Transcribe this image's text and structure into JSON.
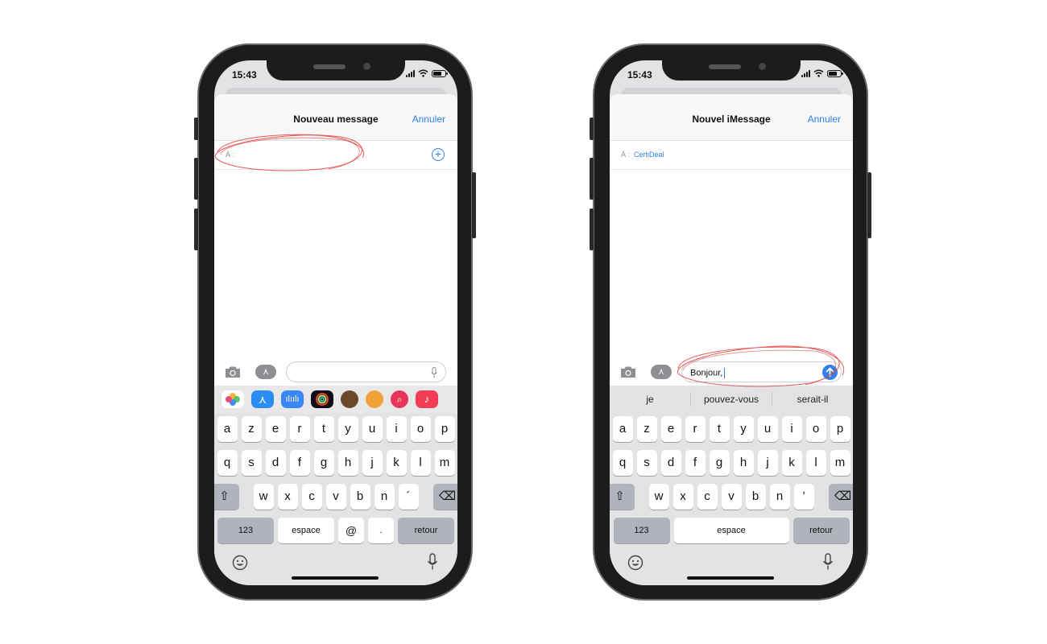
{
  "left_phone": {
    "time": "15:43",
    "nav_title": "Nouveau message",
    "cancel_label": "Annuler",
    "to_label": "À :",
    "recipient": "",
    "message_text": "",
    "keyboard": {
      "row1": [
        "a",
        "z",
        "e",
        "r",
        "t",
        "y",
        "u",
        "i",
        "o",
        "p"
      ],
      "row2": [
        "q",
        "s",
        "d",
        "f",
        "g",
        "h",
        "j",
        "k",
        "l",
        "m"
      ],
      "row3": [
        "w",
        "x",
        "c",
        "v",
        "b",
        "n",
        "´"
      ],
      "numbers_label": "123",
      "space_label": "espace",
      "at_label": "@",
      "dot_label": ".",
      "return_label": "retour"
    }
  },
  "right_phone": {
    "time": "15:43",
    "nav_title": "Nouvel iMessage",
    "cancel_label": "Annuler",
    "to_label": "À :",
    "recipient": "CertiDeal",
    "message_text": "Bonjour,",
    "suggestions": [
      "je",
      "pouvez-vous",
      "serait-il"
    ],
    "keyboard": {
      "row1": [
        "a",
        "z",
        "e",
        "r",
        "t",
        "y",
        "u",
        "i",
        "o",
        "p"
      ],
      "row2": [
        "q",
        "s",
        "d",
        "f",
        "g",
        "h",
        "j",
        "k",
        "l",
        "m"
      ],
      "row3": [
        "w",
        "x",
        "c",
        "v",
        "b",
        "n",
        "’"
      ],
      "numbers_label": "123",
      "space_label": "espace",
      "return_label": "retour"
    }
  },
  "icons": {
    "camera": "camera-icon",
    "apps": "app-store-icon",
    "add": "plus-circle-icon",
    "mic": "microphone-icon",
    "send": "arrow-up-icon",
    "shift": "shift-icon",
    "delete": "backspace-icon",
    "emoji": "emoji-icon"
  },
  "colors": {
    "accent": "#2f80ed",
    "annotation": "#e0403c",
    "keyboard_bg": "#e3e3e6",
    "phone_frame": "#1c1c1c"
  },
  "app_strip": [
    {
      "name": "photos-app-icon",
      "color": "#ffffff"
    },
    {
      "name": "app-store-app-icon",
      "color": "#2b8cf2"
    },
    {
      "name": "audio-app-icon",
      "color": "#3a86f5"
    },
    {
      "name": "fitness-app-icon",
      "color": "#111111"
    },
    {
      "name": "memoji-app-icon",
      "color": "#6b4a2a"
    },
    {
      "name": "animoji-app-icon",
      "color": "#f2a23a"
    },
    {
      "name": "search-images-app-icon",
      "color": "#e8335a"
    },
    {
      "name": "music-app-icon",
      "color": "#f23d55"
    }
  ]
}
